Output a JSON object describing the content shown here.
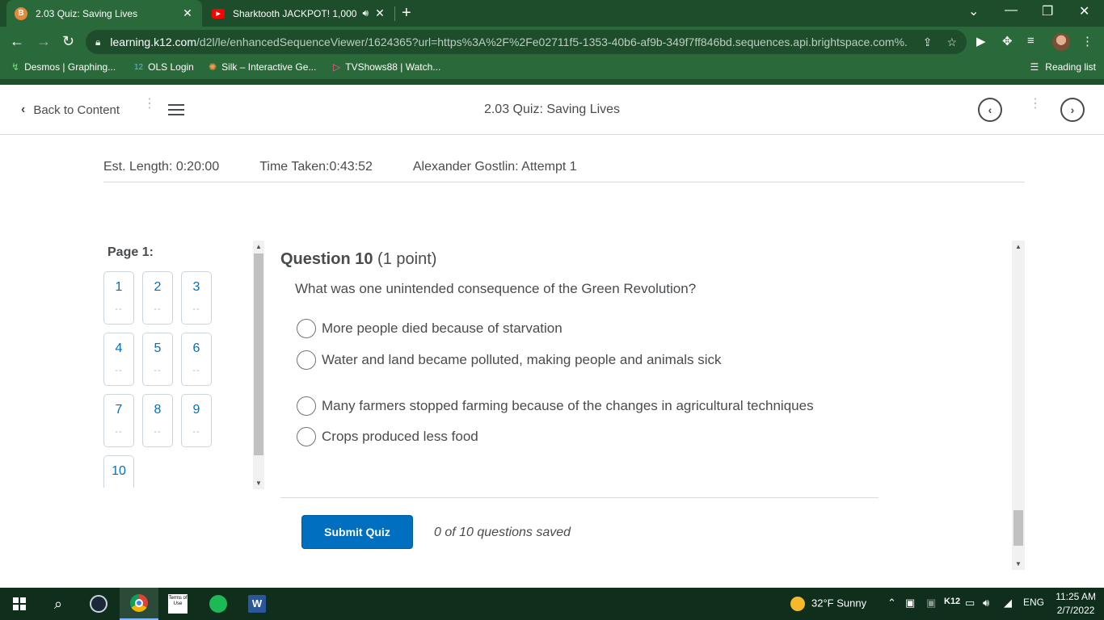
{
  "browser": {
    "tabs": [
      {
        "title": "2.03 Quiz: Saving Lives",
        "favicon": "B",
        "active": true
      },
      {
        "title": "Sharktooth JACKPOT! 1,000 r",
        "favicon": "▶",
        "active": false
      }
    ],
    "url_host": "learning.k12.com",
    "url_rest": "/d2l/le/enhancedSequenceViewer/1624365?url=https%3A%2F%2Fe02711f5-1353-40b6-af9b-349f7ff846bd.sequences.api.brightspace.com%...",
    "bookmarks": [
      {
        "label": "Desmos | Graphing...",
        "icon": "desmos-icon"
      },
      {
        "label": "OLS Login",
        "icon": "k12-icon",
        "icon_text": "12"
      },
      {
        "label": "Silk – Interactive Ge...",
        "icon": "silk-icon"
      },
      {
        "label": "TVShows88 | Watch...",
        "icon": "play-icon"
      }
    ],
    "reading_list": "Reading list"
  },
  "header": {
    "back_label": "Back to Content",
    "title": "2.03 Quiz: Saving Lives"
  },
  "info": {
    "est_length": "Est. Length: 0:20:00",
    "time_taken": "Time Taken:0:43:52",
    "attempt": "Alexander Gostlin: Attempt 1"
  },
  "nav": {
    "page_label": "Page 1:",
    "questions": [
      "1",
      "2",
      "3",
      "4",
      "5",
      "6",
      "7",
      "8",
      "9",
      "10"
    ],
    "dash": "--"
  },
  "question": {
    "number_label": "Question 10",
    "points": "(1 point)",
    "text": "What was one unintended consequence of the Green Revolution?",
    "options": [
      "More people died because of starvation",
      "Water and land became polluted, making people and animals sick",
      "Many farmers stopped farming because of the changes in agricultural techniques",
      "Crops produced less food"
    ]
  },
  "footer": {
    "submit_label": "Submit Quiz",
    "saved_status": "0 of 10 questions saved"
  },
  "taskbar": {
    "weather": "32°F  Sunny",
    "lang": "ENG",
    "k12": "K12",
    "time": "11:25 AM",
    "date": "2/7/2022",
    "word_label": "W",
    "terms_label": "Terms of Use"
  },
  "colors": {
    "chrome_dark": "#1e4d2b",
    "chrome_mid": "#2a6a3a",
    "accent_blue": "#006fbf",
    "text_gray": "#494c4e"
  }
}
